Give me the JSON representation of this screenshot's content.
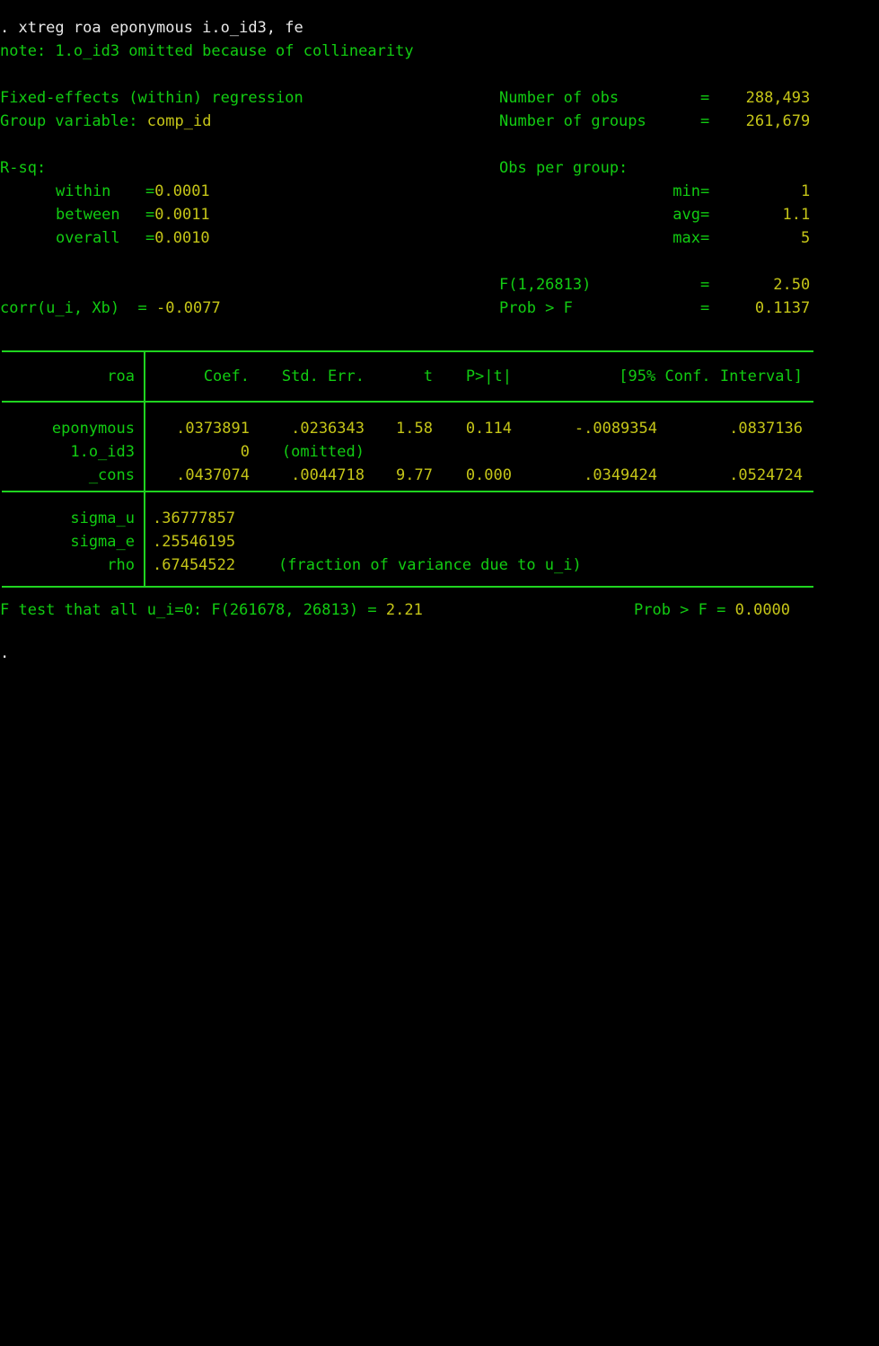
{
  "window": {
    "kind": "stata-results-console",
    "background_color": "#000000",
    "command_color": "#e8e8e8",
    "label_color": "#12cc12",
    "value_color": "#c5c518",
    "rule_color": "#1fd41f"
  },
  "command_line": {
    "prompt": ".",
    "text": ". xtreg roa eponymous i.o_id3, fe"
  },
  "note": "note: 1.o_id3 omitted because of collinearity",
  "header": {
    "title": "Fixed-effects (within) regression",
    "group_variable_label": "Group variable:",
    "group_variable_value": "comp_id",
    "right_stats": [
      {
        "label": "Number of obs",
        "eq": "=",
        "value": "288,493"
      },
      {
        "label": "Number of groups",
        "eq": "=",
        "value": "261,679"
      }
    ]
  },
  "rsq": {
    "heading": "R-sq:",
    "rows": [
      {
        "label": "within",
        "eq": "=",
        "value": "0.0001"
      },
      {
        "label": "between",
        "eq": "=",
        "value": "0.0011"
      },
      {
        "label": "overall",
        "eq": "=",
        "value": "0.0010"
      }
    ]
  },
  "obs_per_group": {
    "heading": "Obs per group:",
    "rows": [
      {
        "label": "min",
        "eq": "=",
        "value": "1"
      },
      {
        "label": "avg",
        "eq": "=",
        "value": "1.1"
      },
      {
        "label": "max",
        "eq": "=",
        "value": "5"
      }
    ]
  },
  "ftest_header": {
    "f_label": "F(1,26813)",
    "f_eq": "=",
    "f_value": "2.50",
    "prob_label": "Prob > F",
    "prob_eq": "=",
    "prob_value": "0.1137"
  },
  "corr": {
    "label": "corr(u_i, Xb)",
    "eq": "=",
    "value": "-0.0077"
  },
  "table": {
    "columns": [
      "roa",
      "Coef.",
      "Std. Err.",
      "t",
      "P>|t|",
      "[95% Conf. Interval]"
    ],
    "rows": [
      {
        "name": "eponymous",
        "coef": ".0373891",
        "stderr": ".0236343",
        "t": "1.58",
        "p": "0.114",
        "ci_low": "-.0089354",
        "ci_high": ".0837136",
        "omitted": false
      },
      {
        "name": "1.o_id3",
        "coef": "0",
        "stderr": "(omitted)",
        "t": "",
        "p": "",
        "ci_low": "",
        "ci_high": "",
        "omitted": true
      },
      {
        "name": "_cons",
        "coef": ".0437074",
        "stderr": ".0044718",
        "t": "9.77",
        "p": "0.000",
        "ci_low": ".0349424",
        "ci_high": ".0524724",
        "omitted": false
      }
    ],
    "variance_rows": [
      {
        "name": "sigma_u",
        "value": ".36777857",
        "note": ""
      },
      {
        "name": "sigma_e",
        "value": ".25546195",
        "note": ""
      },
      {
        "name": "rho",
        "value": ".67454522",
        "note": "(fraction of variance due to u_i)"
      }
    ]
  },
  "footer": {
    "text_label": "F test that all u_i=0: F(261678, 26813) =",
    "text_value": "2.21",
    "prob_label": "Prob > F =",
    "prob_value": "0.0000"
  },
  "trailing_prompt": "."
}
